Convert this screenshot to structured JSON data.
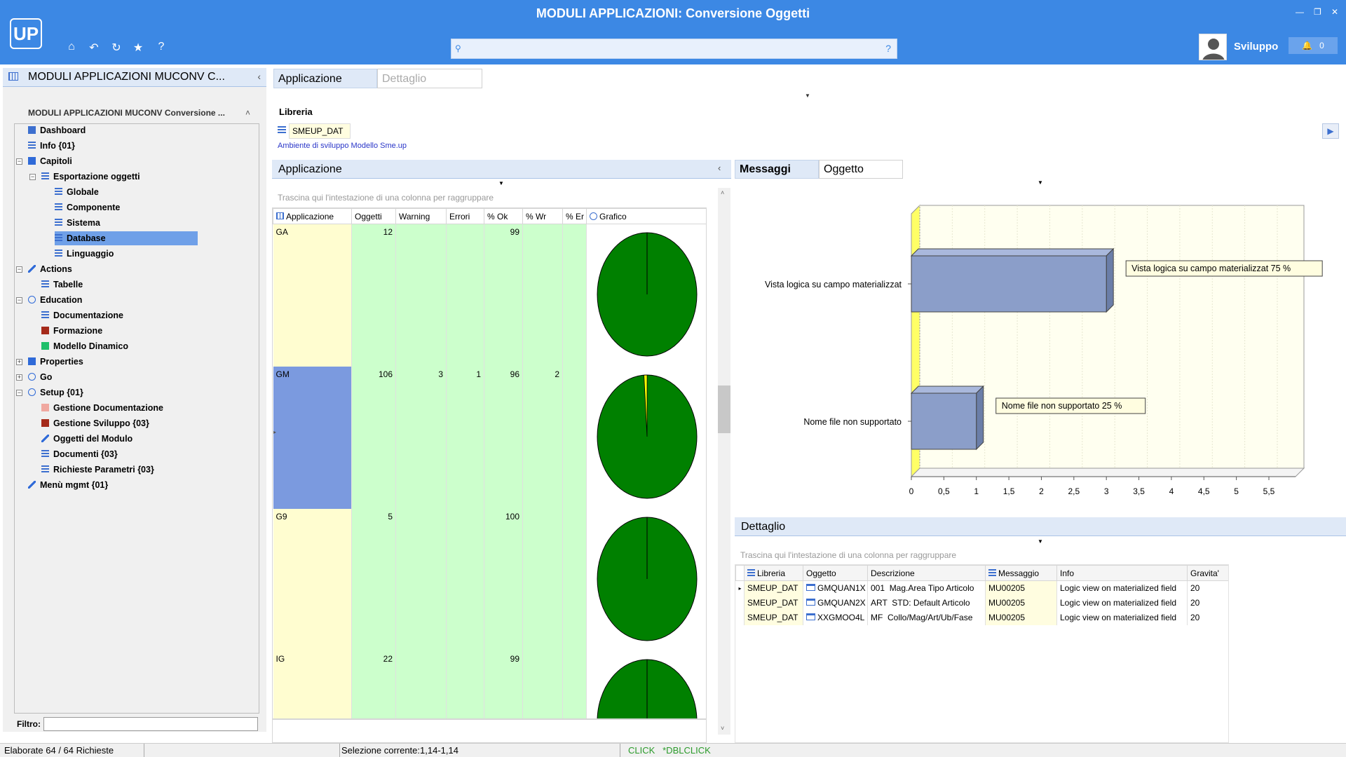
{
  "header": {
    "title": "MODULI APPLICAZIONI: Conversione Oggetti",
    "logo": "UP",
    "user": "Sviluppo",
    "notifications": "0",
    "search_help": "?"
  },
  "left": {
    "title": "MODULI APPLICAZIONI MUCONV C...",
    "tree_title": "MODULI APPLICAZIONI MUCONV Conversione ...",
    "filter_label": "Filtro:",
    "tree": [
      {
        "label": "Dashboard",
        "icon": "grid-icon",
        "color": "#3c6fcf"
      },
      {
        "label": "Info {01}",
        "icon": "list-icon",
        "color": "#3c6fcf"
      },
      {
        "label": "Capitoli",
        "icon": "folder-icon",
        "color": "#2f6ad8"
      },
      {
        "label": "Esportazione oggetti",
        "icon": "table-icon",
        "color": "#3c6fcf"
      },
      {
        "label": "Globale",
        "icon": "table-icon",
        "color": "#3c6fcf"
      },
      {
        "label": "Componente",
        "icon": "table-icon",
        "color": "#3c6fcf"
      },
      {
        "label": "Sistema",
        "icon": "table-icon",
        "color": "#3c6fcf"
      },
      {
        "label": "Database",
        "icon": "table-icon",
        "color": "#3c6fcf"
      },
      {
        "label": "Linguaggio",
        "icon": "table-icon",
        "color": "#3c6fcf"
      },
      {
        "label": "Actions",
        "icon": "pencil-icon",
        "color": "#2f6ad8"
      },
      {
        "label": "Tabelle",
        "icon": "table-icon",
        "color": "#3c6fcf"
      },
      {
        "label": "Education",
        "icon": "info-icon",
        "color": "#2f6ad8"
      },
      {
        "label": "Documentazione",
        "icon": "doc-icon",
        "color": "#3c6fcf"
      },
      {
        "label": "Formazione",
        "icon": "square-icon",
        "color": "#a52a1a"
      },
      {
        "label": "Modello Dinamico",
        "icon": "square-icon",
        "color": "#1fbf6a"
      },
      {
        "label": "Properties",
        "icon": "square-icon",
        "color": "#2f6ad8"
      },
      {
        "label": "Go",
        "icon": "circle-icon",
        "color": "#2f6ad8"
      },
      {
        "label": "Setup {01}",
        "icon": "circle-icon",
        "color": "#2f6ad8"
      },
      {
        "label": "Gestione Documentazione",
        "icon": "square-icon",
        "color": "#f0a8a0"
      },
      {
        "label": "Gestione Sviluppo {03}",
        "icon": "square-icon",
        "color": "#a52a1a"
      },
      {
        "label": "Oggetti del Modulo",
        "icon": "pencil-icon",
        "color": "#2f6ad8"
      },
      {
        "label": "Documenti {03}",
        "icon": "table-icon",
        "color": "#3c6fcf"
      },
      {
        "label": "Richieste Parametri {03}",
        "icon": "table-icon",
        "color": "#3c6fcf"
      },
      {
        "label": "Menù mgmt {01}",
        "icon": "pencil-icon",
        "color": "#2f6ad8"
      }
    ]
  },
  "tabs_main": [
    "Applicazione",
    "Dettaglio"
  ],
  "libreria": {
    "label": "Libreria",
    "value": "SMEUP_DAT",
    "subtitle": "Ambiente di sviluppo Modello Sme.up"
  },
  "app_panel": {
    "title": "Applicazione",
    "group_hint": "Trascina qui l'intestazione di una colonna per raggruppare",
    "columns": [
      "Applicazione",
      "Oggetti",
      "Warning",
      "Errori",
      "% Ok",
      "% Wr",
      "% Er",
      "Grafico"
    ],
    "rows": [
      {
        "app": "GA",
        "oggetti": "12",
        "warning": "",
        "errori": "",
        "ok": "99",
        "wr": "",
        "er": "",
        "pie_ok": 99,
        "pie_wr": 0
      },
      {
        "app": "GM",
        "oggetti": "106",
        "warning": "3",
        "errori": "1",
        "ok": "96",
        "wr": "2",
        "er": "",
        "pie_ok": 96,
        "pie_wr": 2
      },
      {
        "app": "G9",
        "oggetti": "5",
        "warning": "",
        "errori": "",
        "ok": "100",
        "wr": "",
        "er": "",
        "pie_ok": 100,
        "pie_wr": 0
      },
      {
        "app": "IG",
        "oggetti": "22",
        "warning": "",
        "errori": "",
        "ok": "99",
        "wr": "",
        "er": "",
        "pie_ok": 99,
        "pie_wr": 0
      }
    ]
  },
  "tabs_right": [
    "Messaggi",
    "Oggetto"
  ],
  "chart_data": {
    "type": "bar",
    "orientation": "horizontal",
    "categories": [
      "Vista logica su campo materializzat",
      "Nome file  non supportato"
    ],
    "values": [
      3,
      1
    ],
    "data_labels": [
      "Vista logica su campo materializzat 75 %",
      "Nome file  non supportato 25 %"
    ],
    "xlim": [
      0,
      5.5
    ],
    "xticks": [
      "0",
      "0,5",
      "1",
      "1,5",
      "2",
      "2,5",
      "3",
      "3,5",
      "4",
      "4,5",
      "5",
      "5,5"
    ],
    "colors": {
      "bar": "#8b9ec9",
      "wall": "#fffff0",
      "floor": "#ffff66"
    }
  },
  "detail_panel": {
    "title": "Dettaglio",
    "group_hint": "Trascina qui l'intestazione di una colonna per raggruppare",
    "columns": [
      "Libreria",
      "Oggetto",
      "Descrizione",
      "Messaggio",
      "Info",
      "Gravita'"
    ],
    "rows": [
      {
        "libreria": "SMEUP_DAT",
        "oggetto": "GMQUAN1X",
        "descrizione": "001  Mag.Area Tipo Articolo",
        "messaggio": "MU00205",
        "info": "Logic view on materialized field",
        "gravita": "20"
      },
      {
        "libreria": "SMEUP_DAT",
        "oggetto": "GMQUAN2X",
        "descrizione": "ART  STD: Default Articolo",
        "messaggio": "MU00205",
        "info": "Logic view on materialized field",
        "gravita": "20"
      },
      {
        "libreria": "SMEUP_DAT",
        "oggetto": "XXGMOO4L",
        "descrizione": "MF  Collo/Mag/Art/Ub/Fase",
        "messaggio": "MU00205",
        "info": "Logic view on materialized field",
        "gravita": "20"
      }
    ]
  },
  "status": {
    "left": "Elaborate 64 / 64 Richieste",
    "middle": "Selezione corrente:1,14-1,14",
    "right": "CLICK   *DBLCLICK"
  }
}
